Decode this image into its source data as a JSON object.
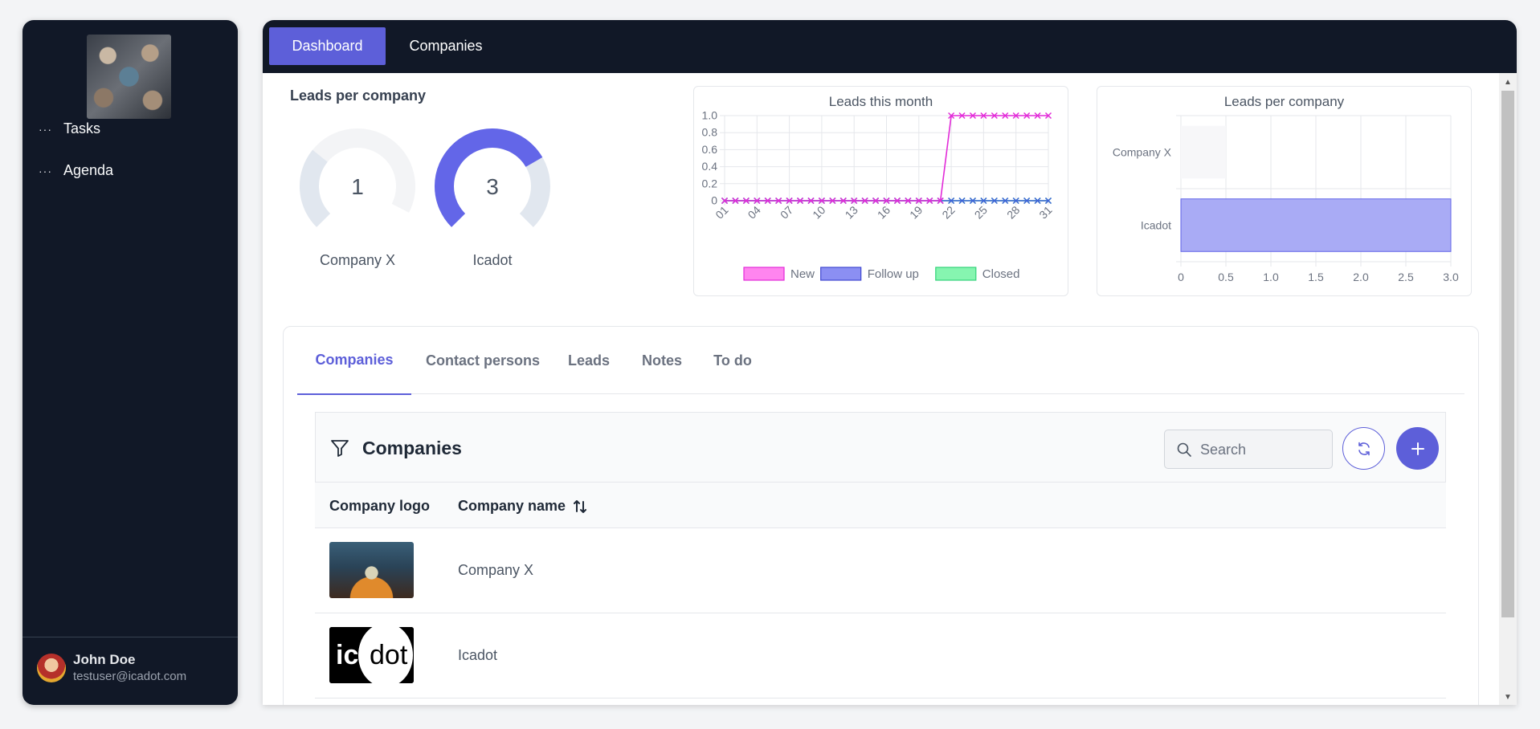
{
  "sidebar": {
    "nav": [
      {
        "label": "Tasks",
        "icon": "dots-icon"
      },
      {
        "label": "Agenda",
        "icon": "dots-icon"
      }
    ],
    "user": {
      "name": "John Doe",
      "email": "testuser@icadot.com"
    }
  },
  "topnav": {
    "tabs": [
      {
        "label": "Dashboard",
        "active": true
      },
      {
        "label": "Companies",
        "active": false
      }
    ]
  },
  "leads_per_company": {
    "title": "Leads per company",
    "donuts": [
      {
        "value": "1",
        "label": "Company X"
      },
      {
        "value": "3",
        "label": "Icadot"
      }
    ]
  },
  "chart_data": [
    {
      "type": "line",
      "title": "Leads this month",
      "x": [
        "01",
        "02",
        "03",
        "04",
        "05",
        "06",
        "07",
        "08",
        "09",
        "10",
        "11",
        "12",
        "13",
        "14",
        "15",
        "16",
        "17",
        "18",
        "19",
        "20",
        "21",
        "22",
        "23",
        "24",
        "25",
        "26",
        "27",
        "28",
        "29",
        "30",
        "31"
      ],
      "x_tick_labels": [
        "01",
        "04",
        "07",
        "10",
        "13",
        "16",
        "19",
        "22",
        "25",
        "28",
        "31"
      ],
      "ylim": [
        0,
        1
      ],
      "y_ticks": [
        "0",
        "0.2",
        "0.4",
        "0.6",
        "0.8",
        "1.0"
      ],
      "series": [
        {
          "name": "New",
          "color": "#e22bd8",
          "values": [
            0,
            0,
            0,
            0,
            0,
            0,
            0,
            0,
            0,
            0,
            0,
            0,
            0,
            0,
            0,
            0,
            0,
            0,
            0,
            0,
            0,
            1,
            1,
            1,
            1,
            1,
            1,
            1,
            1,
            1,
            1
          ]
        },
        {
          "name": "Follow up",
          "color": "#3f63d9",
          "values": [
            0,
            0,
            0,
            0,
            0,
            0,
            0,
            0,
            0,
            0,
            0,
            0,
            0,
            0,
            0,
            0,
            0,
            0,
            0,
            0,
            0,
            0,
            0,
            0,
            0,
            0,
            0,
            0,
            0,
            0,
            0
          ]
        },
        {
          "name": "Closed",
          "color": "#33d37a",
          "values": [
            0,
            0,
            0,
            0,
            0,
            0,
            0,
            0,
            0,
            0,
            0,
            0,
            0,
            0,
            0,
            0,
            0,
            0,
            0,
            0,
            0,
            0,
            0,
            0,
            0,
            0,
            0,
            0,
            0,
            0,
            0
          ]
        }
      ],
      "legend": [
        {
          "name": "New",
          "fill": "#ff85ef",
          "stroke": "#e22bd8"
        },
        {
          "name": "Follow up",
          "fill": "#8b8ff3",
          "stroke": "#3f47d0"
        },
        {
          "name": "Closed",
          "fill": "#86f5b0",
          "stroke": "#33d37a"
        }
      ],
      "grid": true,
      "legend_position": "bottom"
    },
    {
      "type": "bar",
      "orientation": "horizontal",
      "title": "Leads per company",
      "categories": [
        "Company X",
        "Icadot"
      ],
      "values": [
        1,
        3
      ],
      "colors": [
        "#f7f7f9",
        "#a9abf5"
      ],
      "xlim": [
        0,
        3
      ],
      "x_ticks": [
        "0",
        "0.5",
        "1.0",
        "1.5",
        "2.0",
        "2.5",
        "3.0"
      ],
      "grid": true
    }
  ],
  "tabs": [
    {
      "label": "Companies",
      "active": true
    },
    {
      "label": "Contact persons",
      "active": false
    },
    {
      "label": "Leads",
      "active": false
    },
    {
      "label": "Notes",
      "active": false
    },
    {
      "label": "To do",
      "active": false
    }
  ],
  "companies_table": {
    "title": "Companies",
    "search_placeholder": "Search",
    "columns": [
      "Company logo",
      "Company name"
    ],
    "rows": [
      {
        "name": "Company X"
      },
      {
        "name": "Icadot",
        "logo_text_a": "ica",
        "logo_text_b": "dot"
      }
    ]
  },
  "colors": {
    "accent": "#5d5fd9",
    "sidebar_bg": "#111827"
  }
}
